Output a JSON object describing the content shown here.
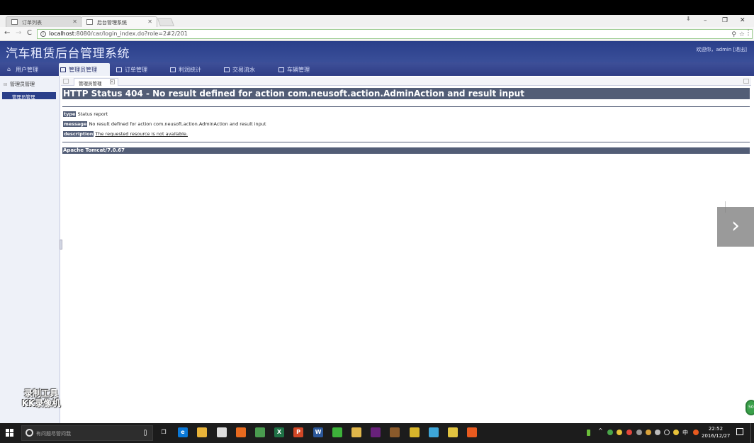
{
  "browser": {
    "tabs": [
      {
        "title": "订单列表",
        "active": false
      },
      {
        "title": "后台管理系统",
        "active": true
      }
    ],
    "url_host": "localhost",
    "url_path": ":8080/car/login_index.do?role=2#2/201",
    "window_controls": {
      "minimize": "–",
      "restore": "❐",
      "close": "✕"
    }
  },
  "app": {
    "title": "汽车租赁后台管理系统",
    "welcome": "欢迎你，admin  [退出]",
    "nav": [
      {
        "label": "用户管理",
        "icon": "home-icon",
        "active": false
      },
      {
        "label": "管理员管理",
        "icon": "admin-icon",
        "active": true
      },
      {
        "label": "订单管理",
        "icon": "order-icon",
        "active": false
      },
      {
        "label": "利润统计",
        "icon": "stats-icon",
        "active": false
      },
      {
        "label": "交易流水",
        "icon": "ledger-icon",
        "active": false
      },
      {
        "label": "车辆管理",
        "icon": "car-icon",
        "active": false
      }
    ],
    "sidebar": {
      "heading": "管理员管理",
      "items": [
        {
          "label": "管理员管理",
          "selected": true
        }
      ]
    },
    "content_tabs": [
      {
        "label": "管理员管理"
      }
    ]
  },
  "error_page": {
    "heading": "HTTP Status 404 - No result defined for action com.neusoft.action.AdminAction and result input",
    "type_label": "type",
    "type_value": "Status report",
    "message_label": "message",
    "message_value": "No result defined for action com.neusoft.action.AdminAction and result input",
    "description_label": "description",
    "description_value": "The requested resource is not available.",
    "footer": "Apache Tomcat/7.0.67"
  },
  "overlay": {
    "watermark_line1": "录制工具",
    "watermark_line2": "KK录像机",
    "next_arrow": "›",
    "bubble": "50"
  },
  "taskbar": {
    "search_placeholder": "有问题尽管问我",
    "ime": "中",
    "time": "22:52",
    "date": "2016/12/27",
    "apps": [
      {
        "name": "task-view",
        "color": "#1c1c1c",
        "glyph": "❐"
      },
      {
        "name": "edge",
        "color": "#0a78d7",
        "glyph": "e"
      },
      {
        "name": "file-explorer",
        "color": "#e8b339",
        "glyph": ""
      },
      {
        "name": "store",
        "color": "#dddddd",
        "glyph": ""
      },
      {
        "name": "firefox",
        "color": "#e86a1f",
        "glyph": ""
      },
      {
        "name": "chrome",
        "color": "#4a9b4f",
        "glyph": ""
      },
      {
        "name": "excel",
        "color": "#1e7145",
        "glyph": "X"
      },
      {
        "name": "powerpoint",
        "color": "#d24726",
        "glyph": "P"
      },
      {
        "name": "word",
        "color": "#2b579a",
        "glyph": "W"
      },
      {
        "name": "wechat",
        "color": "#3db23a",
        "glyph": ""
      },
      {
        "name": "photo-app",
        "color": "#e0b64a",
        "glyph": ""
      },
      {
        "name": "visual-studio",
        "color": "#68217a",
        "glyph": ""
      },
      {
        "name": "screen-recorder",
        "color": "#8a5a2b",
        "glyph": ""
      },
      {
        "name": "browser-yellow",
        "color": "#d8b52b",
        "glyph": ""
      },
      {
        "name": "notes-app",
        "color": "#3ea6d9",
        "glyph": ""
      },
      {
        "name": "archive-app",
        "color": "#e2c440",
        "glyph": ""
      },
      {
        "name": "qq-app",
        "color": "#e85a1f",
        "glyph": ""
      }
    ]
  }
}
